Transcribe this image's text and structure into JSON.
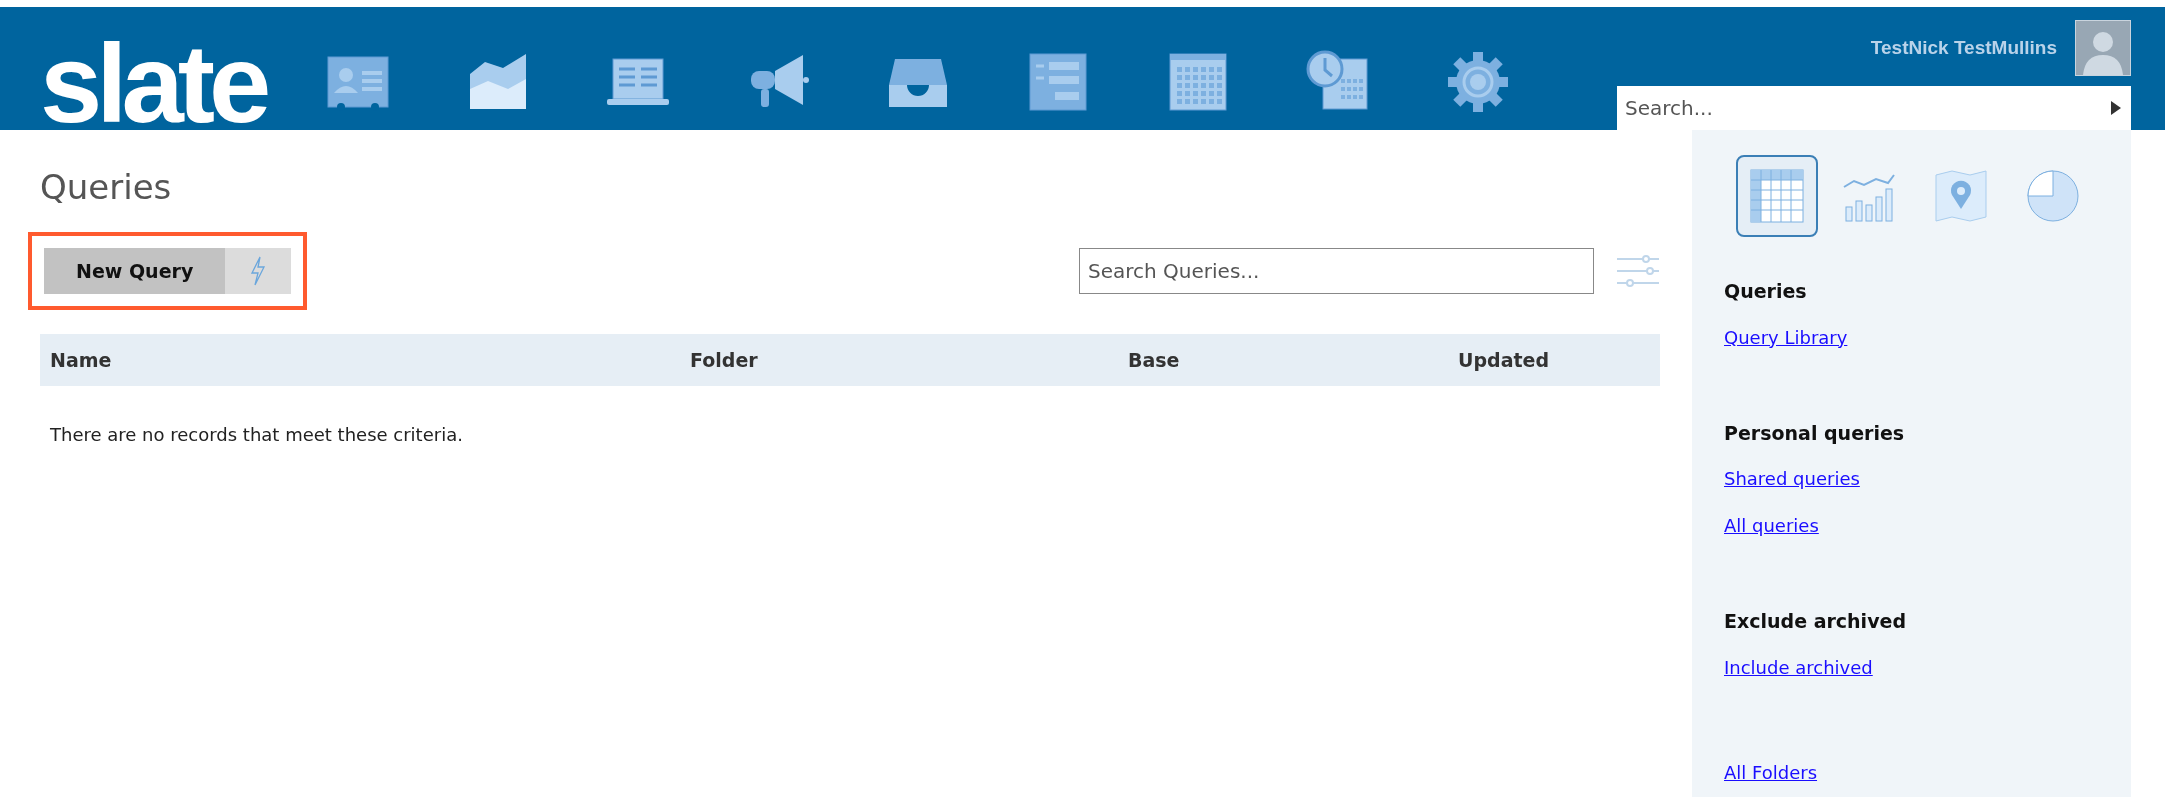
{
  "header": {
    "logo": "slate",
    "user_name": "TestNick TestMullins",
    "search": {
      "placeholder": "Search..."
    }
  },
  "page": {
    "title": "Queries",
    "new_button": "New Query",
    "search": {
      "placeholder": "Search Queries..."
    },
    "table": {
      "columns": [
        "Name",
        "Folder",
        "Base",
        "Updated"
      ],
      "empty_message": "There are no records that meet these criteria."
    }
  },
  "sidebar": {
    "view_buttons": [
      {
        "kind": "table",
        "selected": true
      },
      {
        "kind": "chart",
        "selected": false
      },
      {
        "kind": "map",
        "selected": false
      },
      {
        "kind": "pie",
        "selected": false
      }
    ],
    "sections": [
      {
        "title": "Queries",
        "links": [
          "Query Library"
        ]
      },
      {
        "title": "Personal queries",
        "links": [
          "Shared queries",
          "All queries"
        ]
      },
      {
        "title": "Exclude archived",
        "links": [
          "Include archived"
        ]
      },
      {
        "links": [
          "All Folders"
        ]
      }
    ]
  }
}
